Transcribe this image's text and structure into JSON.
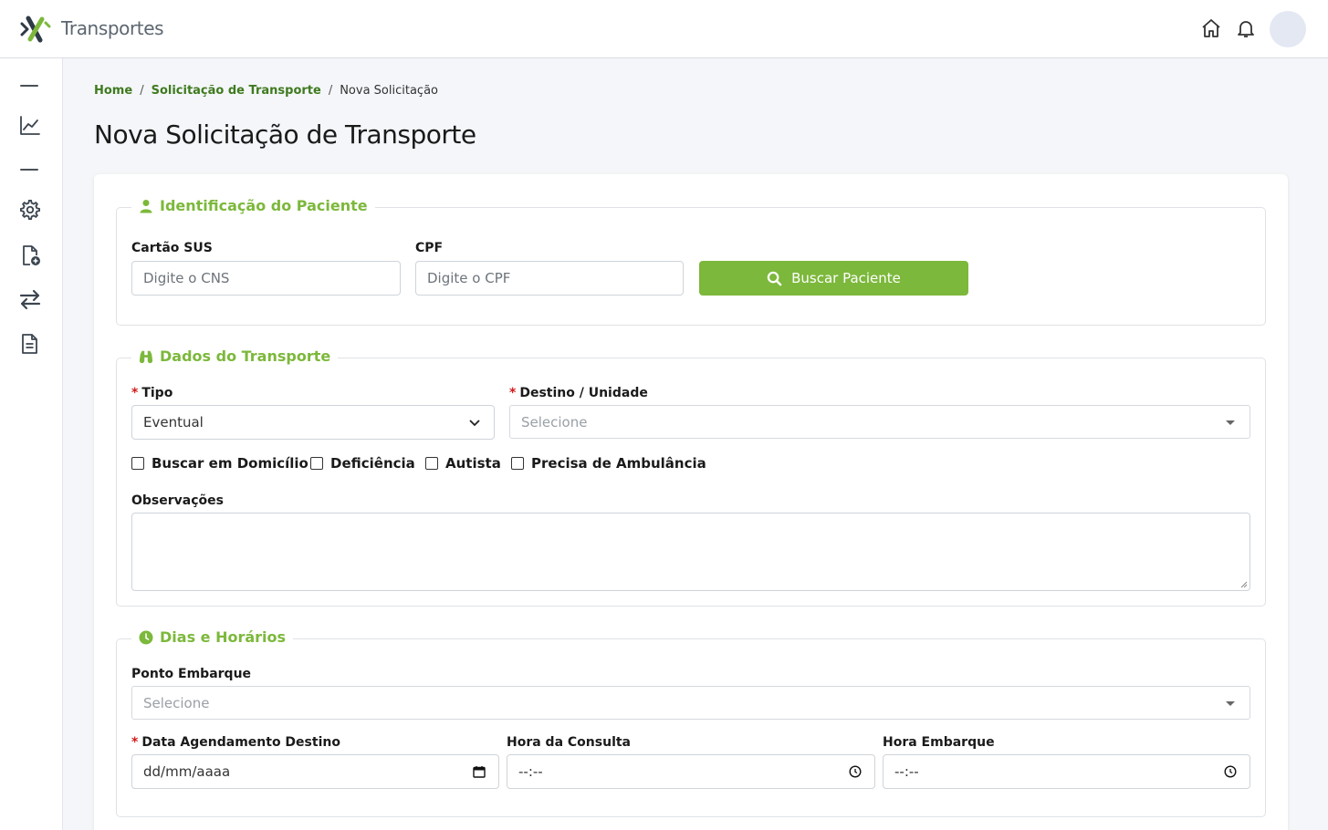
{
  "header": {
    "app_title": "Transportes",
    "brand_colors": {
      "dark": "#2e3a45",
      "green": "#7cb83b"
    },
    "icons": [
      "home-icon",
      "bell-icon"
    ]
  },
  "sidebar": {
    "items": [
      "chart-line-icon",
      "gear-icon",
      "file-add-icon",
      "transfer-arrows-icon",
      "document-icon"
    ]
  },
  "breadcrumb": {
    "home": "Home",
    "level1": "Solicitação de Transporte",
    "current": "Nova Solicitação"
  },
  "page": {
    "title": "Nova Solicitação de Transporte"
  },
  "paciente": {
    "legend": "Identificação do Paciente",
    "cns_label": "Cartão SUS",
    "cns_placeholder": "Digite o CNS",
    "cpf_label": "CPF",
    "cpf_placeholder": "Digite o CPF",
    "search_button": "Buscar Paciente"
  },
  "transporte": {
    "legend": "Dados do Transporte",
    "required_mark": "*",
    "tipo_label": "Tipo",
    "tipo_value": "Eventual",
    "destino_label": "Destino / Unidade",
    "destino_placeholder": "Selecione",
    "checkboxes": [
      "Buscar em Domicílio",
      "Deficiência",
      "Autista",
      "Precisa de Ambulância"
    ],
    "obs_label": "Observações"
  },
  "horarios": {
    "legend": "Dias e Horários",
    "embarque_label": "Ponto Embarque",
    "embarque_placeholder": "Selecione",
    "data_label": "Data Agendamento Destino",
    "data_placeholder": "dd/mm/aaaa",
    "hora_consulta_label": "Hora da Consulta",
    "hora_consulta_placeholder": "--:--",
    "hora_embarque_label": "Hora Embarque",
    "hora_embarque_placeholder": "--:--"
  }
}
